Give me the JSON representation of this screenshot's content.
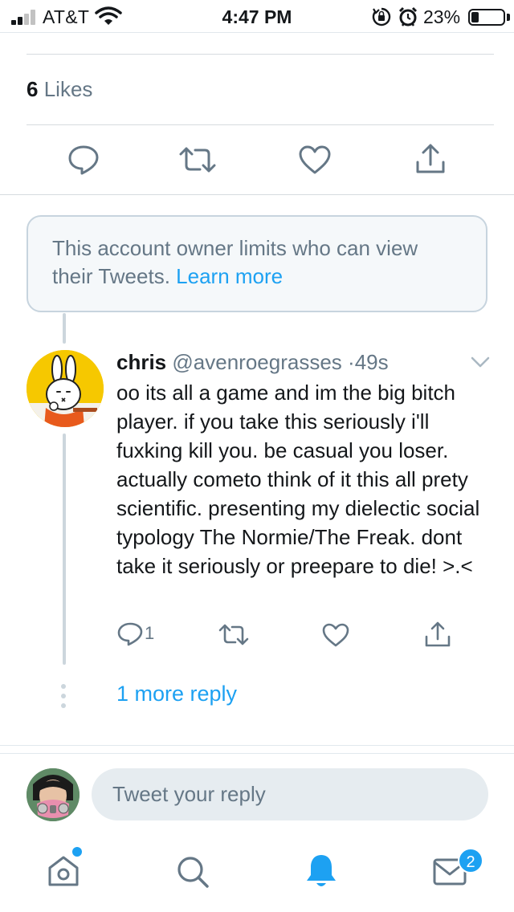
{
  "status_bar": {
    "carrier": "AT&T",
    "time": "4:47 PM",
    "battery_percent": "23%",
    "battery_level": 0.23,
    "signal_bars": 2,
    "icons": [
      "signal-icon",
      "wifi-icon",
      "rotation-lock-icon",
      "alarm-icon",
      "battery-icon"
    ]
  },
  "likes": {
    "count": "6",
    "label": "Likes"
  },
  "main_actions": [
    "reply-icon",
    "retweet-icon",
    "like-icon",
    "share-icon"
  ],
  "notice": {
    "text": "This account owner limits who can view their Tweets.",
    "link": "Learn more"
  },
  "reply_tweet": {
    "name": "chris",
    "handle": "@avenroegrasses",
    "separator": "·",
    "time": "49s",
    "body": "oo its all a game and im the big bitch player. if you take this seriously i'll fuxking kill you. be casual you loser. actually cometo think of it this all prety scientific. presenting my dielectic social typology The Normie/The Freak. dont take it seriously or preepare to die! >.<",
    "reply_count": "1"
  },
  "more_replies": "1 more reply",
  "compose": {
    "placeholder": "Tweet your reply"
  },
  "tab_bar": {
    "items": [
      "home-icon",
      "search-icon",
      "notifications-icon",
      "messages-icon"
    ],
    "messages_badge": "2",
    "active": "notifications"
  },
  "colors": {
    "accent": "#1da1f2",
    "secondary_text": "#657786",
    "divider": "#d6dbdf",
    "notice_bg": "#f5f8fa",
    "input_bg": "#e6ecf0"
  }
}
